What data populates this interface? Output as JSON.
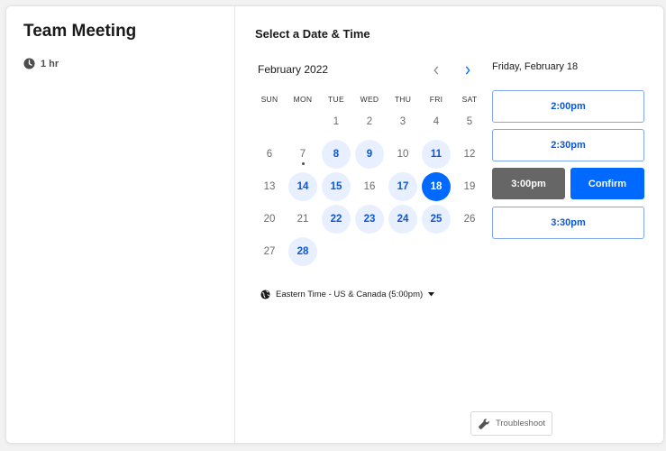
{
  "event": {
    "title": "Team Meeting",
    "duration": "1 hr",
    "duration_icon": "clock-icon"
  },
  "scheduler": {
    "heading": "Select a Date & Time",
    "month_label": "February 2022",
    "prev_icon": "chevron-left-icon",
    "next_icon": "chevron-right-icon",
    "weekdays": [
      "SUN",
      "MON",
      "TUE",
      "WED",
      "THU",
      "FRI",
      "SAT"
    ],
    "days": [
      {
        "label": "1",
        "state": "disabled"
      },
      {
        "label": "2",
        "state": "disabled"
      },
      {
        "label": "3",
        "state": "disabled"
      },
      {
        "label": "4",
        "state": "disabled"
      },
      {
        "label": "5",
        "state": "disabled"
      },
      {
        "label": "6",
        "state": "disabled"
      },
      {
        "label": "7",
        "state": "today"
      },
      {
        "label": "8",
        "state": "available"
      },
      {
        "label": "9",
        "state": "available"
      },
      {
        "label": "10",
        "state": "disabled"
      },
      {
        "label": "11",
        "state": "available"
      },
      {
        "label": "12",
        "state": "disabled"
      },
      {
        "label": "13",
        "state": "disabled"
      },
      {
        "label": "14",
        "state": "available"
      },
      {
        "label": "15",
        "state": "available"
      },
      {
        "label": "16",
        "state": "disabled"
      },
      {
        "label": "17",
        "state": "available"
      },
      {
        "label": "18",
        "state": "selected"
      },
      {
        "label": "19",
        "state": "disabled"
      },
      {
        "label": "20",
        "state": "disabled"
      },
      {
        "label": "21",
        "state": "disabled"
      },
      {
        "label": "22",
        "state": "available"
      },
      {
        "label": "23",
        "state": "available"
      },
      {
        "label": "24",
        "state": "available"
      },
      {
        "label": "25",
        "state": "available"
      },
      {
        "label": "26",
        "state": "disabled"
      },
      {
        "label": "27",
        "state": "disabled"
      },
      {
        "label": "28",
        "state": "available"
      }
    ],
    "first_weekday_index": 2,
    "timezone": {
      "label": "Eastern Time - US & Canada (5:00pm)",
      "icon": "globe-icon",
      "dropdown_icon": "caret-down-icon"
    }
  },
  "times": {
    "date_heading": "Friday, February 18",
    "slots": [
      "2:00pm",
      "2:30pm"
    ],
    "selected_slot": "3:00pm",
    "confirm_label": "Confirm",
    "slots_after": [
      "3:30pm"
    ]
  },
  "footer": {
    "troubleshoot_label": "Troubleshoot",
    "troubleshoot_icon": "wrench-icon"
  },
  "colors": {
    "accent": "#0069ff",
    "available_bg": "#e8efff",
    "selected_slot_bg": "#666666"
  }
}
